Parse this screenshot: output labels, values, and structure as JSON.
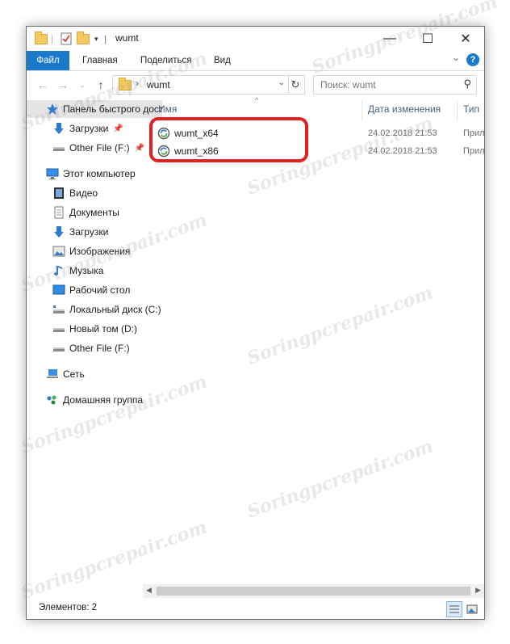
{
  "window": {
    "title": "wumt"
  },
  "titlebar": {
    "minimize_glyph": "—",
    "maximize_glyph": "☐",
    "close_glyph": "✕"
  },
  "ribbon": {
    "tabs": [
      "Файл",
      "Главная",
      "Поделиться",
      "Вид"
    ],
    "help_glyph": "?",
    "accent": "#1979ca"
  },
  "address": {
    "crumb": "wumt",
    "search_placeholder": "Поиск: wumt"
  },
  "nav": {
    "items": [
      {
        "label": "Панель быстрого доступа",
        "icon": "star-icon",
        "pinned": false
      },
      {
        "label": "Загрузки",
        "icon": "download-icon",
        "pinned": true
      },
      {
        "label": "Other File (F:)",
        "icon": "drive-icon",
        "pinned": true
      },
      {
        "label": "Этот компьютер",
        "icon": "computer-icon",
        "pinned": false
      },
      {
        "label": "Видео",
        "icon": "video-icon",
        "pinned": false
      },
      {
        "label": "Документы",
        "icon": "documents-icon",
        "pinned": false
      },
      {
        "label": "Загрузки",
        "icon": "download-icon",
        "pinned": false
      },
      {
        "label": "Изображения",
        "icon": "pictures-icon",
        "pinned": false
      },
      {
        "label": "Музыка",
        "icon": "music-icon",
        "pinned": false
      },
      {
        "label": "Рабочий стол",
        "icon": "desktop-icon",
        "pinned": false
      },
      {
        "label": "Локальный диск (C:)",
        "icon": "system-drive-icon",
        "pinned": false
      },
      {
        "label": "Новый том (D:)",
        "icon": "drive-icon",
        "pinned": false
      },
      {
        "label": "Other File (F:)",
        "icon": "drive-icon",
        "pinned": false
      },
      {
        "label": "Сеть",
        "icon": "network-icon",
        "pinned": false
      },
      {
        "label": "Домашняя группа",
        "icon": "homegroup-icon",
        "pinned": false
      }
    ]
  },
  "columns": [
    "Имя",
    "Дата изменения",
    "Тип"
  ],
  "files": [
    {
      "name": "wumt_x64",
      "date": "24.02.2018 21:53",
      "type": "Приложение"
    },
    {
      "name": "wumt_x86",
      "date": "24.02.2018 21:53",
      "type": "Приложение"
    }
  ],
  "status": {
    "text": "Элементов: 2"
  },
  "watermark": "Soringpcrepair.com",
  "colors": {
    "highlight": "#e32020",
    "selected": "#e5e5e5"
  }
}
